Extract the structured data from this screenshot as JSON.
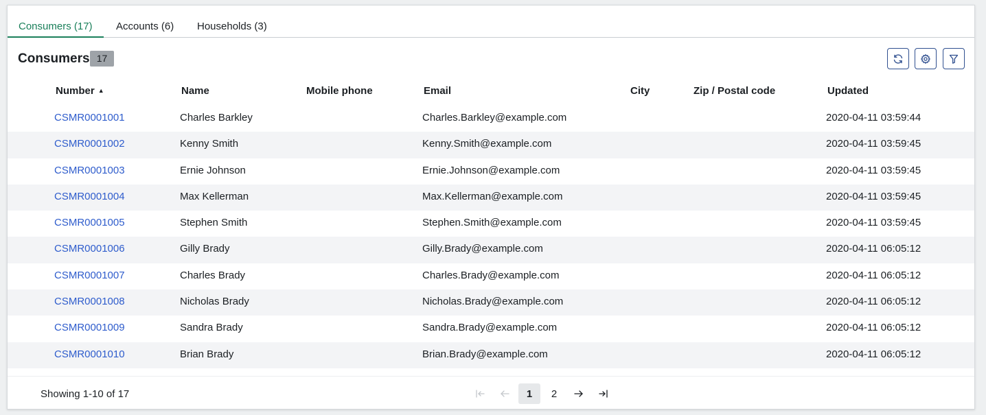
{
  "tabs": [
    {
      "label": "Consumers (17)",
      "active": true
    },
    {
      "label": "Accounts (6)",
      "active": false
    },
    {
      "label": "Households (3)",
      "active": false
    }
  ],
  "list": {
    "title": "Consumers",
    "count": "17",
    "toolbar_icons": [
      "refresh-icon",
      "gear-icon",
      "filter-icon"
    ]
  },
  "table": {
    "columns": [
      "Number",
      "Name",
      "Mobile phone",
      "Email",
      "City",
      "Zip / Postal code",
      "Updated"
    ],
    "sort": {
      "column": "Number",
      "direction": "ascending"
    },
    "rows": [
      {
        "number": "CSMR0001001",
        "name": "Charles Barkley",
        "mobile": "",
        "email": "Charles.Barkley@example.com",
        "city": "",
        "zip": "",
        "updated": "2020-04-11 03:59:44"
      },
      {
        "number": "CSMR0001002",
        "name": "Kenny Smith",
        "mobile": "",
        "email": "Kenny.Smith@example.com",
        "city": "",
        "zip": "",
        "updated": "2020-04-11 03:59:45"
      },
      {
        "number": "CSMR0001003",
        "name": "Ernie Johnson",
        "mobile": "",
        "email": "Ernie.Johnson@example.com",
        "city": "",
        "zip": "",
        "updated": "2020-04-11 03:59:45"
      },
      {
        "number": "CSMR0001004",
        "name": "Max Kellerman",
        "mobile": "",
        "email": "Max.Kellerman@example.com",
        "city": "",
        "zip": "",
        "updated": "2020-04-11 03:59:45"
      },
      {
        "number": "CSMR0001005",
        "name": "Stephen Smith",
        "mobile": "",
        "email": "Stephen.Smith@example.com",
        "city": "",
        "zip": "",
        "updated": "2020-04-11 03:59:45"
      },
      {
        "number": "CSMR0001006",
        "name": "Gilly Brady",
        "mobile": "",
        "email": "Gilly.Brady@example.com",
        "city": "",
        "zip": "",
        "updated": "2020-04-11 06:05:12"
      },
      {
        "number": "CSMR0001007",
        "name": "Charles Brady",
        "mobile": "",
        "email": "Charles.Brady@example.com",
        "city": "",
        "zip": "",
        "updated": "2020-04-11 06:05:12"
      },
      {
        "number": "CSMR0001008",
        "name": "Nicholas Brady",
        "mobile": "",
        "email": "Nicholas.Brady@example.com",
        "city": "",
        "zip": "",
        "updated": "2020-04-11 06:05:12"
      },
      {
        "number": "CSMR0001009",
        "name": "Sandra Brady",
        "mobile": "",
        "email": "Sandra.Brady@example.com",
        "city": "",
        "zip": "",
        "updated": "2020-04-11 06:05:12"
      },
      {
        "number": "CSMR0001010",
        "name": "Brian Brady",
        "mobile": "",
        "email": "Brian.Brady@example.com",
        "city": "",
        "zip": "",
        "updated": "2020-04-11 06:05:12"
      }
    ]
  },
  "footer": {
    "showing": "Showing 1-10 of 17",
    "pages": [
      "1",
      "2"
    ],
    "current_page": "1"
  },
  "colors": {
    "active_tab": "#1a7f5a",
    "link": "#2e5ccc",
    "badge": "#9ea3a8",
    "icon_button_border": "#2f4f8f"
  }
}
